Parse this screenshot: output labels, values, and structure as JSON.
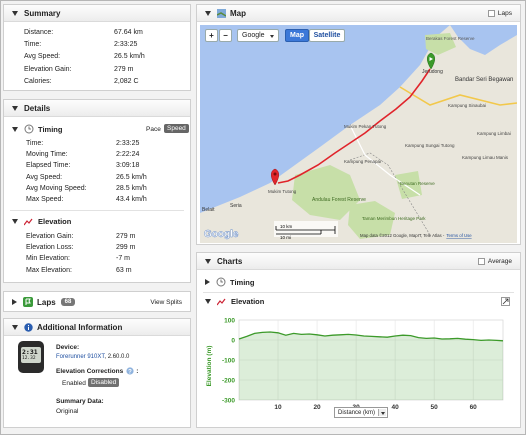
{
  "summary": {
    "title": "Summary",
    "rows": [
      {
        "label": "Distance:",
        "value": "67.64 km"
      },
      {
        "label": "Time:",
        "value": "2:33:25"
      },
      {
        "label": "Avg Speed:",
        "value": "26.5 km/h"
      },
      {
        "label": "Elevation Gain:",
        "value": "279 m"
      },
      {
        "label": "Calories:",
        "value": "2,082 C"
      }
    ]
  },
  "details": {
    "title": "Details",
    "timing": {
      "title": "Timing",
      "pace_label": "Pace",
      "speed_label": "Speed",
      "rows": [
        {
          "label": "Time:",
          "value": "2:33:25"
        },
        {
          "label": "Moving Time:",
          "value": "2:22:24"
        },
        {
          "label": "Elapsed Time:",
          "value": "3:09:18"
        },
        {
          "label": "Avg Speed:",
          "value": "26.5 km/h"
        },
        {
          "label": "Avg Moving Speed:",
          "value": "28.5 km/h"
        },
        {
          "label": "Max Speed:",
          "value": "43.4 km/h"
        }
      ]
    },
    "elevation": {
      "title": "Elevation",
      "rows": [
        {
          "label": "Elevation Gain:",
          "value": "279 m"
        },
        {
          "label": "Elevation Loss:",
          "value": "299 m"
        },
        {
          "label": "Min Elevation:",
          "value": "-7 m"
        },
        {
          "label": "Max Elevation:",
          "value": "63 m"
        }
      ]
    }
  },
  "laps": {
    "title": "Laps",
    "count": "68",
    "view_splits": "View Splits"
  },
  "additional": {
    "title": "Additional Information",
    "device_label": "Device:",
    "device_name": "Forerunner 910XT",
    "device_version": ", 2.60.0.0",
    "elev_corr_label": "Elevation Corrections",
    "enabled": "Enabled",
    "disabled": "Disabled",
    "summary_data_label": "Summary Data:",
    "summary_data_value": "Original",
    "watch_time": "2:31",
    "watch_small": "12.32"
  },
  "map": {
    "title": "Map",
    "laps_label": "Laps",
    "zoom_in": "+",
    "zoom_out": "−",
    "layer_select": "Google",
    "map_btn": "Map",
    "satellite_btn": "Satellite",
    "places": [
      "Berakas Forest Reserve",
      "Jerudong",
      "Bandar Seri Begawan",
      "Kampung Sinaubai",
      "Kampung Limbai",
      "Kampung Limau Manis",
      "Mukim Pekan Tutong",
      "Kampung Sungai Tutong",
      "Kampung Penapar",
      "Andulau Forest Reserve",
      "Mukim Tutong",
      "Taman Merimbun Heritage Park",
      "Benutan Reserve",
      "Belait",
      "Seria"
    ],
    "scale_km": "10 km",
    "scale_mi": "10 mi",
    "attribution": "Map data ©2012 Google, MapIT, Tele Atlas -",
    "terms": "Terms of Use",
    "logo": "Google",
    "colors": {
      "route": "#e0242b",
      "water": "#a8c4f0",
      "land": "#e9e6dc",
      "forest": "#c7dfa8"
    }
  },
  "charts": {
    "title": "Charts",
    "average_label": "Average",
    "timing_label": "Timing",
    "elevation_label": "Elevation"
  },
  "chart_data": {
    "type": "area",
    "title": "",
    "xlabel": "Distance (km)",
    "ylabel": "Elevation (m)",
    "xlim": [
      0,
      67.64
    ],
    "ylim": [
      -300,
      100
    ],
    "xticks": [
      10,
      20,
      30,
      40,
      50,
      60
    ],
    "yticks": [
      100,
      0,
      -100,
      -200,
      -300
    ],
    "color": "#3c9a2a",
    "x": [
      0,
      2,
      4,
      6,
      8,
      10,
      12,
      14,
      16,
      18,
      20,
      22,
      24,
      26,
      28,
      30,
      32,
      34,
      36,
      38,
      40,
      42,
      44,
      46,
      48,
      50,
      52,
      54,
      56,
      58,
      60,
      62,
      64,
      66,
      67.64
    ],
    "y": [
      5,
      18,
      33,
      38,
      40,
      36,
      24,
      33,
      28,
      30,
      26,
      20,
      24,
      26,
      28,
      25,
      20,
      18,
      16,
      14,
      20,
      24,
      22,
      12,
      8,
      10,
      5,
      6,
      8,
      4,
      2,
      -2,
      0,
      -2,
      -4
    ]
  }
}
